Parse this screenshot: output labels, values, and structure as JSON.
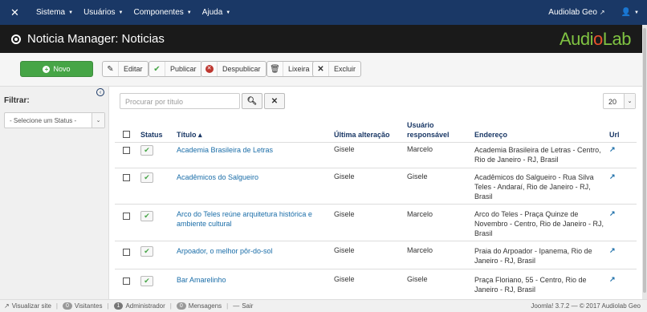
{
  "topnav": {
    "menu": [
      {
        "label": "Sistema"
      },
      {
        "label": "Usuários"
      },
      {
        "label": "Componentes"
      },
      {
        "label": "Ajuda"
      }
    ],
    "site_link": "Audiolab Geo"
  },
  "header": {
    "title": "Noticia Manager: Noticias",
    "brand_pre": "Audi",
    "brand_dot": "o",
    "brand_post": "Lab"
  },
  "toolbar": {
    "new": "Novo",
    "edit": "Editar",
    "publish": "Publicar",
    "unpublish": "Despublicar",
    "trash": "Lixeira",
    "delete": "Excluir"
  },
  "sidebar": {
    "filter_label": "Filtrar:",
    "status_select": "- Selecione um Status -"
  },
  "search": {
    "placeholder": "Procurar por título",
    "limit": "20"
  },
  "table": {
    "headers": {
      "status": "Status",
      "titulo": "Título ▴",
      "alteracao": "Última alteração",
      "responsavel_1": "Usuário",
      "responsavel_2": "responsável",
      "endereco": "Endereço",
      "url": "Url"
    },
    "rows": [
      {
        "titulo": "Academia Brasileira de Letras",
        "alteracao": "Gisele",
        "responsavel": "Marcelo",
        "endereco": "Academia Brasileira de Letras - Centro, Rio de Janeiro - RJ, Brasil"
      },
      {
        "titulo": "Acadêmicos do Salgueiro",
        "alteracao": "Gisele",
        "responsavel": "Gisele",
        "endereco": "Acadêmicos do Salgueiro - Rua Silva Teles - Andaraí, Rio de Janeiro - RJ, Brasil"
      },
      {
        "titulo": "Arco do Teles reúne arquitetura histórica e ambiente cultural",
        "alteracao": "Gisele",
        "responsavel": "Marcelo",
        "endereco": "Arco do Teles - Praça Quinze de Novembro - Centro, Rio de Janeiro - RJ, Brasil"
      },
      {
        "titulo": "Arpoador, o melhor pôr-do-sol",
        "alteracao": "Gisele",
        "responsavel": "Marcelo",
        "endereco": "Praia do Arpoador - Ipanema, Rio de Janeiro - RJ, Brasil"
      },
      {
        "titulo": "Bar Amarelinho",
        "alteracao": "Gisele",
        "responsavel": "Gisele",
        "endereco": "Praça Floriano, 55 - Centro, Rio de Janeiro - RJ, Brasil"
      }
    ]
  },
  "statusbar": {
    "view_site": "Visualizar site",
    "visitors_count": "0",
    "visitors": "Visitantes",
    "admin_count": "1",
    "admin": "Administrador",
    "messages_count": "0",
    "messages": "Mensagens",
    "logout": "Sair",
    "copyright": "Joomla! 3.7.2 — © 2017 Audiolab Geo"
  }
}
